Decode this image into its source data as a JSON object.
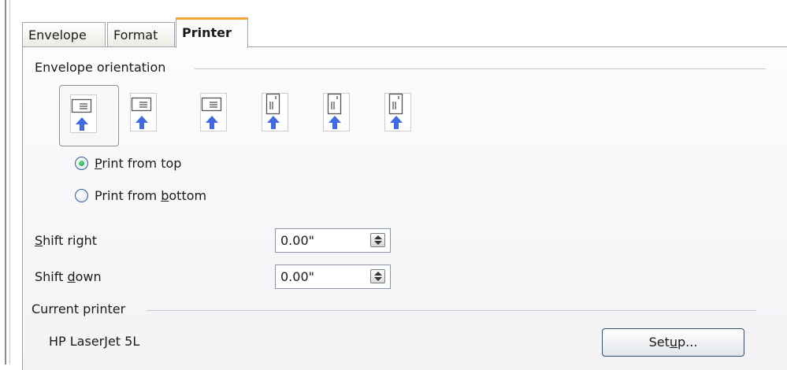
{
  "tabs": [
    {
      "label": "Envelope",
      "active": false
    },
    {
      "label": "Format",
      "active": false
    },
    {
      "label": "Printer",
      "active": true
    }
  ],
  "orientation_group": {
    "title": "Envelope orientation",
    "options": [
      {
        "icon": "envelope-horizontal-left-icon",
        "selected": true
      },
      {
        "icon": "envelope-horizontal-center-icon",
        "selected": false
      },
      {
        "icon": "envelope-horizontal-right-icon",
        "selected": false
      },
      {
        "icon": "envelope-vertical-left-icon",
        "selected": false
      },
      {
        "icon": "envelope-vertical-center-icon",
        "selected": false
      },
      {
        "icon": "envelope-vertical-right-icon",
        "selected": false
      }
    ]
  },
  "print_from": {
    "top": {
      "prefix": "",
      "mnemonic": "P",
      "suffix": "rint from top",
      "checked": true
    },
    "bottom": {
      "prefix": "Print from ",
      "mnemonic": "b",
      "suffix": "ottom",
      "checked": false
    }
  },
  "shift_right": {
    "prefix": "",
    "mnemonic": "S",
    "suffix": "hift right",
    "value": "0.00\""
  },
  "shift_down": {
    "prefix": "Shift ",
    "mnemonic": "d",
    "suffix": "own",
    "value": "0.00\""
  },
  "current_printer": {
    "title": "Current printer",
    "name": "HP LaserJet 5L",
    "setup": {
      "prefix": "Set",
      "mnemonic": "u",
      "suffix": "p..."
    }
  },
  "colors": {
    "active_tab_accent": "#f2a531",
    "arrow": "#4169e1",
    "radio_checked": "#1d9c3c"
  }
}
